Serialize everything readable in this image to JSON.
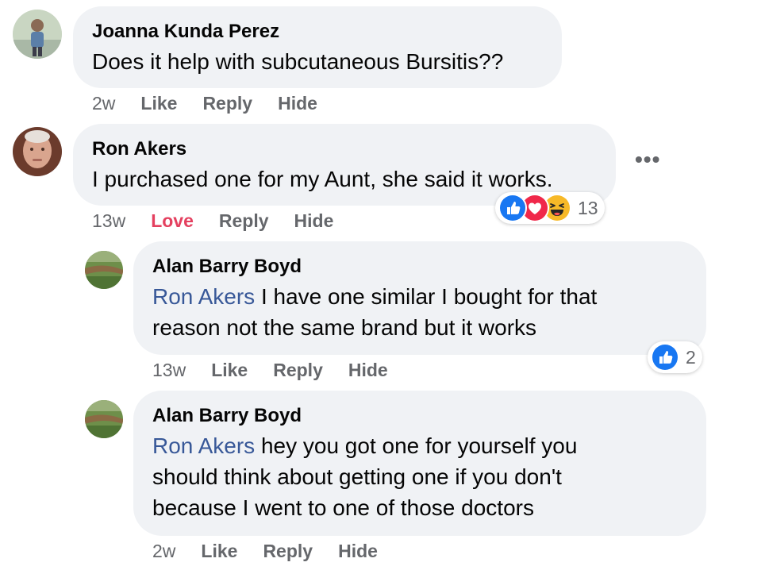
{
  "colors": {
    "bubble": "#f0f2f5",
    "meta_text": "#65676b",
    "love": "#e4405f",
    "mention": "#385898",
    "like_blue": "#1877f2"
  },
  "comments": [
    {
      "author": "Joanna Kunda Perez",
      "text": "Does it help with subcutaneous Bursitis??",
      "time": "2w",
      "actions": [
        "Like",
        "Reply",
        "Hide"
      ]
    },
    {
      "author": "Ron Akers",
      "text": "I purchased one for my Aunt, she said it works.",
      "time": "13w",
      "actions": [
        "Love",
        "Reply",
        "Hide"
      ],
      "more_icon": "more-horizontal-icon",
      "reactions": {
        "icons": [
          "like-reaction-icon",
          "love-reaction-icon",
          "haha-reaction-icon"
        ],
        "count": "13"
      }
    },
    {
      "author": "Alan Barry Boyd",
      "mention": "Ron Akers",
      "text_line1": " I have one similar I bought for that",
      "text_line2": "reason not the same brand but it works",
      "time": "13w",
      "actions": [
        "Like",
        "Reply",
        "Hide"
      ],
      "reactions": {
        "icons": [
          "like-reaction-icon"
        ],
        "count": "2"
      }
    },
    {
      "author": "Alan Barry Boyd",
      "mention": "Ron Akers",
      "text_line1": " hey you got one for yourself you",
      "text_line2": "should think about getting one if you don't",
      "text_line3": "because I went to one of those doctors",
      "time": "2w",
      "actions": [
        "Like",
        "Reply",
        "Hide"
      ]
    }
  ]
}
